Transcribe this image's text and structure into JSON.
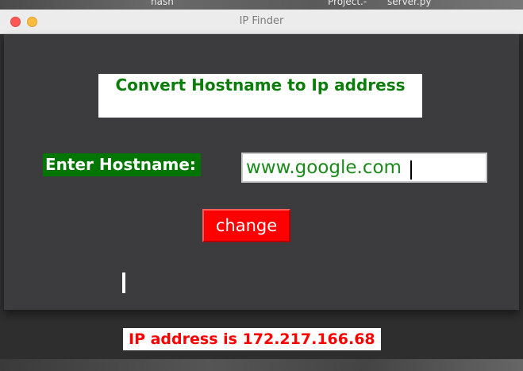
{
  "desktop": {
    "top_labels": [
      "hash",
      "Project.-",
      "server.py"
    ]
  },
  "window": {
    "title": "IP Finder"
  },
  "form": {
    "heading": "Convert Hostname to Ip address",
    "host_label": "Enter Hostname:",
    "host_value": "www.google.com",
    "change_label": "change"
  },
  "result": {
    "text": "IP address is 172.217.166.68"
  },
  "colors": {
    "heading_text": "#0b7d0b",
    "label_bg": "#007500",
    "button_bg": "#ff0000",
    "result_text": "#ff0000",
    "window_bg": "#3c3b3d"
  }
}
